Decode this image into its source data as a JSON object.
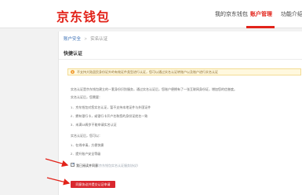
{
  "header": {
    "logo": "京东钱包",
    "nav": [
      "我的京东钱包",
      "账户管理",
      "功能介绍"
    ],
    "active_nav_index": 1
  },
  "breadcrumb": {
    "parent": "账户安全",
    "separator": ">",
    "current": "实名认证"
  },
  "card": {
    "title": "快捷认证"
  },
  "notice": {
    "text": "不支持大陆居民身份证外的有效证件类型进行认证，您可以通过实名认证转账户以及账户进行实名认证"
  },
  "body": {
    "intro": [
      "实名认证是京东钱包建立的一套身份识别服务，通过实名认证后，您账户便拥有了一张互联网身份证，增加您的信誉度。",
      "实名认证后，您需要："
    ],
    "steps": [
      "1．京东钱包对您实名认证，暂不支持本地证件与外国证件",
      "2．拥有银行卡，或银行卡开户名和您的身份证姓名一致",
      "3．未满18周岁不能申请实名认证"
    ],
    "methods_title": "实名认证后，您可以：",
    "methods": [
      "1．在线申请，方便快捷",
      "2．提升账户安全等级"
    ]
  },
  "agree": {
    "label": "我已阅读并同意",
    "link": "《京东钱包实名认证服务协议》",
    "checked": true
  },
  "submit": {
    "label": "同意协议并提交认证申请"
  },
  "colors": {
    "brand_red": "#e2231a",
    "button_red": "#d9272e",
    "notice_bg": "#fff8de",
    "link_blue": "#3a6fb5"
  }
}
